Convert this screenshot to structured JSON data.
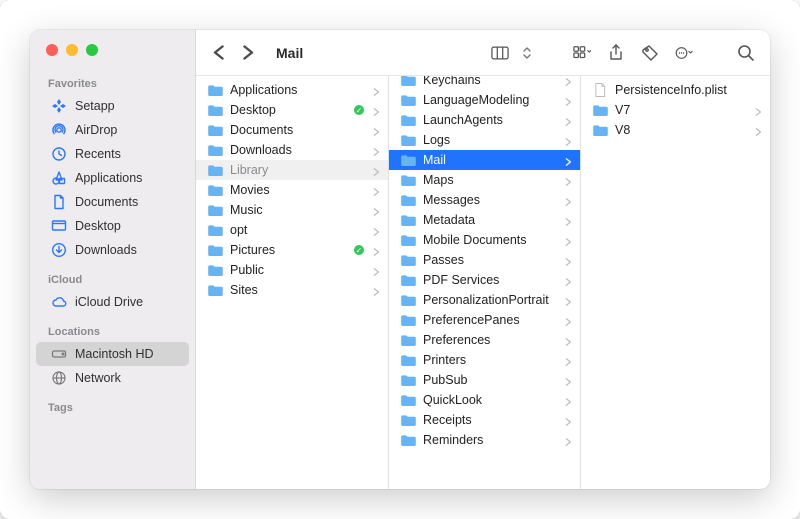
{
  "window": {
    "title": "Mail"
  },
  "sidebar": {
    "sections": [
      {
        "heading": "Favorites",
        "items": [
          {
            "icon": "setapp",
            "label": "Setapp"
          },
          {
            "icon": "airdrop",
            "label": "AirDrop"
          },
          {
            "icon": "recents",
            "label": "Recents"
          },
          {
            "icon": "apps",
            "label": "Applications"
          },
          {
            "icon": "doc",
            "label": "Documents"
          },
          {
            "icon": "desktop",
            "label": "Desktop"
          },
          {
            "icon": "downloads",
            "label": "Downloads"
          }
        ]
      },
      {
        "heading": "iCloud",
        "items": [
          {
            "icon": "cloud",
            "label": "iCloud Drive"
          }
        ]
      },
      {
        "heading": "Locations",
        "items": [
          {
            "icon": "hdd",
            "label": "Macintosh HD",
            "selected": true
          },
          {
            "icon": "globe",
            "label": "Network"
          }
        ]
      },
      {
        "heading": "Tags",
        "items": []
      }
    ]
  },
  "columns": {
    "a": [
      {
        "label": "Applications"
      },
      {
        "label": "Desktop",
        "sync": true
      },
      {
        "label": "Documents"
      },
      {
        "label": "Downloads"
      },
      {
        "label": "Library",
        "hollow": true,
        "selected": true
      },
      {
        "label": "Movies"
      },
      {
        "label": "Music"
      },
      {
        "label": "opt"
      },
      {
        "label": "Pictures",
        "sync": true
      },
      {
        "label": "Public"
      },
      {
        "label": "Sites"
      }
    ],
    "b": [
      {
        "label": "Keychains",
        "cut": true
      },
      {
        "label": "LanguageModeling"
      },
      {
        "label": "LaunchAgents"
      },
      {
        "label": "Logs"
      },
      {
        "label": "Mail",
        "selected": true
      },
      {
        "label": "Maps"
      },
      {
        "label": "Messages"
      },
      {
        "label": "Metadata"
      },
      {
        "label": "Mobile Documents"
      },
      {
        "label": "Passes"
      },
      {
        "label": "PDF Services"
      },
      {
        "label": "PersonalizationPortrait"
      },
      {
        "label": "PreferencePanes"
      },
      {
        "label": "Preferences"
      },
      {
        "label": "Printers"
      },
      {
        "label": "PubSub"
      },
      {
        "label": "QuickLook"
      },
      {
        "label": "Receipts"
      },
      {
        "label": "Reminders"
      }
    ],
    "c": [
      {
        "label": "PersistenceInfo.plist",
        "type": "file"
      },
      {
        "label": "V7",
        "type": "folder"
      },
      {
        "label": "V8",
        "type": "folder"
      }
    ]
  }
}
